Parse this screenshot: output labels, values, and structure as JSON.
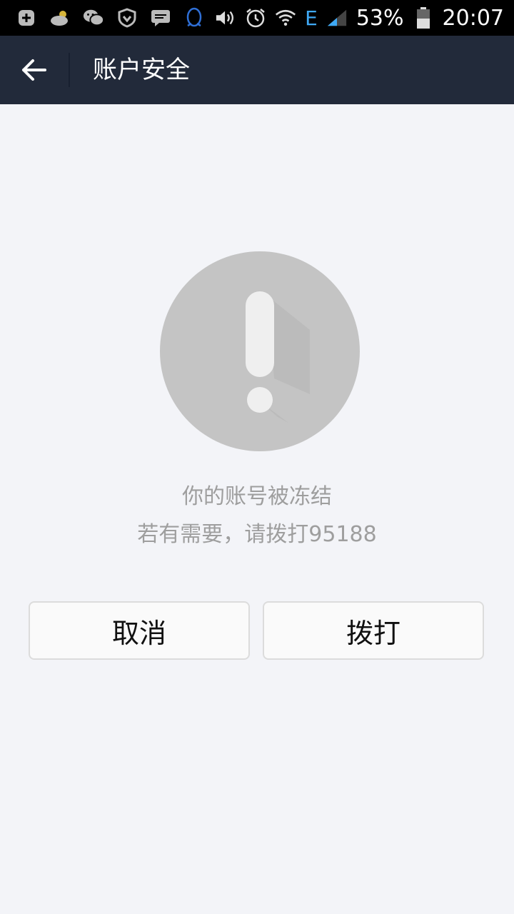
{
  "status_bar": {
    "battery_percent": "53%",
    "time": "20:07",
    "network_type": "E",
    "icons": [
      "notification-plus-icon",
      "weather-cloud-icon",
      "wechat-icon",
      "vpn-shield-icon",
      "message-icon",
      "qq-icon",
      "volume-icon",
      "alarm-icon",
      "wifi-icon",
      "signal-icon",
      "battery-icon"
    ]
  },
  "header": {
    "title": "账户安全",
    "back_icon": "back-arrow-icon"
  },
  "alert": {
    "icon": "exclamation-icon",
    "line1": "你的账号被冻结",
    "line2": "若有需要，请拨打95188"
  },
  "actions": {
    "cancel_label": "取消",
    "call_label": "拨打"
  },
  "colors": {
    "header_bg": "#222a3a",
    "page_bg": "#f3f4f8",
    "circle": "#c4c4c4",
    "message_text": "#9e9e9e"
  }
}
